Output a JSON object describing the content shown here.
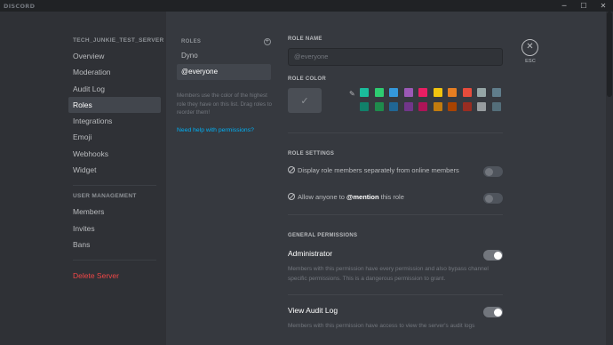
{
  "titlebar": {
    "brand": "DISCORD",
    "minimize_glyph": "─",
    "maximize_glyph": "☐",
    "close_glyph": "✕"
  },
  "sidebar": {
    "server_name": "TECH_JUNKIE_TEST_SERVER",
    "items": [
      {
        "label": "Overview"
      },
      {
        "label": "Moderation"
      },
      {
        "label": "Audit Log"
      },
      {
        "label": "Roles",
        "active": true
      },
      {
        "label": "Integrations"
      },
      {
        "label": "Emoji"
      },
      {
        "label": "Webhooks"
      },
      {
        "label": "Widget"
      }
    ],
    "user_management_header": "USER MANAGEMENT",
    "user_items": [
      {
        "label": "Members"
      },
      {
        "label": "Invites"
      },
      {
        "label": "Bans"
      }
    ],
    "delete_label": "Delete Server"
  },
  "roles": {
    "header": "ROLES",
    "add_icon": "plus-circle-icon",
    "items": [
      {
        "label": "Dyno"
      },
      {
        "label": "@everyone",
        "active": true
      }
    ],
    "help_text": "Members use the color of the highest role they have on this list. Drag roles to reorder them!",
    "help_link": "Need help with permissions?"
  },
  "role_settings": {
    "role_name_label": "ROLE NAME",
    "role_name_placeholder": "@everyone",
    "role_color_label": "ROLE COLOR",
    "default_color_check": "✓",
    "eyedropper_glyph": "✎",
    "swatches_row1": [
      "#1abc9c",
      "#2ecc71",
      "#3498db",
      "#9b59b6",
      "#e91e63",
      "#f1c40f",
      "#e67e22",
      "#e74c3c",
      "#95a5a6",
      "#607d8b"
    ],
    "swatches_row2": [
      "#11806a",
      "#1f8b4c",
      "#206694",
      "#71368a",
      "#ad1457",
      "#c27c0e",
      "#a84300",
      "#992d22",
      "#979c9f",
      "#546e7a"
    ],
    "settings_header": "ROLE SETTINGS",
    "setting_hoist": "Display role members separately from online members",
    "setting_mention_prefix": "Allow anyone to ",
    "setting_mention_bold": "@mention",
    "setting_mention_suffix": " this role",
    "general_header": "GENERAL PERMISSIONS",
    "admin_title": "Administrator",
    "admin_desc": "Members with this permission have every permission and also bypass channel specific permissions. This is a dangerous permission to grant.",
    "audit_title": "View Audit Log",
    "audit_desc": "Members with this permission have access to view the server's audit logs"
  },
  "esc": {
    "glyph": "✕",
    "label": "ESC"
  }
}
